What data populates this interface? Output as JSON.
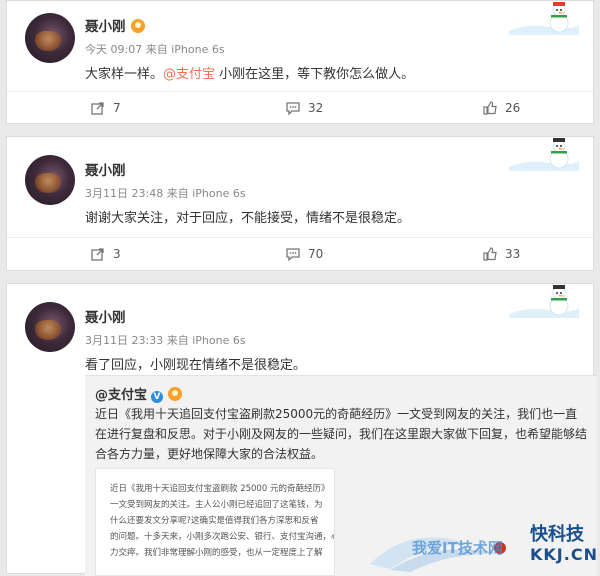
{
  "posts": [
    {
      "author": "聂小刚",
      "time": "今天 09:07",
      "source_prefix": "来自",
      "source": "iPhone 6s",
      "text_before": "大家样一样。",
      "mention": "@支付宝",
      "text_after": " 小刚在这里，等下教你怎么做人。",
      "repost_count": "7",
      "comment_count": "32",
      "like_count": "26"
    },
    {
      "author": "聂小刚",
      "time": "3月11日 23:48",
      "source_prefix": "来自",
      "source": "iPhone 6s",
      "text": "谢谢大家关注，对于回应，不能接受，情绪不是很稳定。",
      "repost_count": "3",
      "comment_count": "70",
      "like_count": "33"
    },
    {
      "author": "聂小刚",
      "time": "3月11日 23:33",
      "source_prefix": "来自",
      "source": "iPhone 6s",
      "text": "看了回应，小刚现在情绪不是很稳定。",
      "quote": {
        "author": "@支付宝",
        "body": "近日《我用十天追回支付宝盗刷款25000元的奇葩经历》一文受到网友的关注，我们也一直在进行复盘和反思。对于小刚及网友的一些疑问，我们在这里跟大家做下回复，也希望能够结合各方力量，更好地保障大家的合法权益。",
        "image_lines": [
          "近日《我用十天追回支付宝盗刷款 25000 元的奇葩经历》",
          "一文受到网友的关注。主人公小刚已经追回了这笔钱，为",
          "什么还要发文分享呢?这确实是值得我们各方深思和反省",
          "的问题。十多天来，小刚多次跑公安、银行、支付宝沟通，心",
          "力交瘁。我们非常理解小刚的感受，也从一定程度上了解"
        ]
      }
    }
  ],
  "watermark": {
    "text1": "我爱IT技术网",
    "text2": "快科技",
    "text3": "KKJ.CN"
  },
  "icons": {
    "repost": "repost-icon",
    "comment": "comment-icon",
    "like": "like-icon",
    "vip": "vip-badge-icon",
    "verified": "verified-v-icon",
    "snowman": "snowman-decoration-icon"
  },
  "colors": {
    "mention": "#eb7350",
    "verified": "#2f8ce0",
    "vip": "#f7a02a"
  }
}
